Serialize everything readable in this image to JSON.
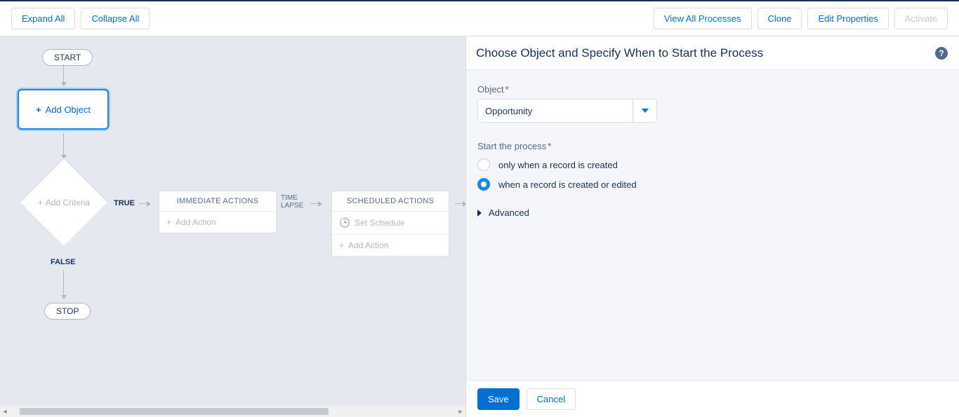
{
  "toolbar": {
    "left": {
      "expand_all": "Expand All",
      "collapse_all": "Collapse All"
    },
    "right": {
      "view_all": "View All Processes",
      "clone": "Clone",
      "edit_properties": "Edit Properties",
      "activate": "Activate"
    }
  },
  "canvas": {
    "start_label": "START",
    "stop_label": "STOP",
    "add_object_label": "Add Object",
    "add_criteria_label": "Add Criteria",
    "true_label": "TRUE",
    "false_label": "FALSE",
    "time_lapse_label_1": "TIME",
    "time_lapse_label_2": "LAPSE",
    "immediate_actions_label": "IMMEDIATE ACTIONS",
    "scheduled_actions_label": "SCHEDULED ACTIONS",
    "add_action_label": "Add Action",
    "set_schedule_label": "Set Schedule"
  },
  "panel": {
    "title": "Choose Object and Specify When to Start the Process",
    "object_label": "Object",
    "object_value": "Opportunity",
    "start_process_label": "Start the process",
    "option_created": "only when a record is created",
    "option_created_edited": "when a record is created or edited",
    "advanced_label": "Advanced",
    "save_label": "Save",
    "cancel_label": "Cancel"
  }
}
